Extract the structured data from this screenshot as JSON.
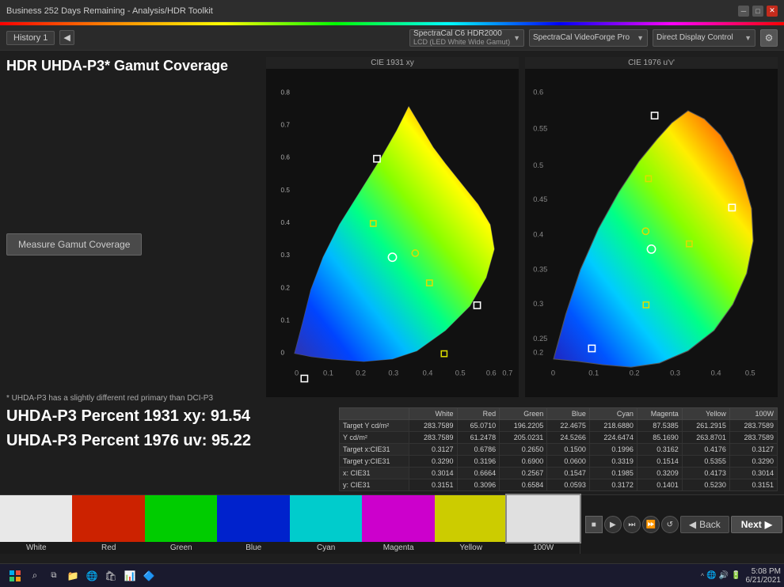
{
  "titlebar": {
    "title": "Business 252 Days Remaining  -  Analysis/HDR Toolkit",
    "controls": [
      "minimize",
      "maximize",
      "close"
    ]
  },
  "toolbar": {
    "history_label": "History 1",
    "device1": {
      "label": "SpectraCal C6 HDR2000",
      "sublabel": "LCD (LED White Wide Gamut)"
    },
    "device2": {
      "label": "SpectraCal VideoForge Pro"
    },
    "device3": {
      "label": "Direct Display Control"
    }
  },
  "main": {
    "panel_title": "HDR UHDA-P3* Gamut Coverage",
    "measure_btn": "Measure Gamut Coverage",
    "chart1_label": "CIE 1931 xy",
    "chart2_label": "CIE 1976 u'v'"
  },
  "bottom": {
    "footnote": "* UHDA-P3 has a slightly different red primary than DCI-P3",
    "stat1": "UHDA-P3 Percent 1931 xy: 91.54",
    "stat2": "UHDA-P3 Percent 1976 uv: 95.22"
  },
  "table": {
    "headers": [
      "",
      "White",
      "Red",
      "Green",
      "Blue",
      "Cyan",
      "Magenta",
      "Yellow",
      "100W"
    ],
    "rows": [
      {
        "label": "Target Y cd/m²",
        "values": [
          "283.7589",
          "65.0710",
          "196.2205",
          "22.4675",
          "218.6880",
          "87.5385",
          "261.2915",
          "283.7589"
        ]
      },
      {
        "label": "Y cd/m²",
        "values": [
          "283.7589",
          "61.2478",
          "205.0231",
          "24.5266",
          "224.6474",
          "85.1690",
          "263.8701",
          "283.7589"
        ]
      },
      {
        "label": "Target x:CIE31",
        "values": [
          "0.3127",
          "0.6786",
          "0.2650",
          "0.1500",
          "0.1996",
          "0.3162",
          "0.4176",
          "0.3127"
        ]
      },
      {
        "label": "Target y:CIE31",
        "values": [
          "0.3290",
          "0.3196",
          "0.6900",
          "0.0600",
          "0.3319",
          "0.1514",
          "0.5355",
          "0.3290"
        ]
      },
      {
        "label": "x: CIE31",
        "values": [
          "0.3014",
          "0.6664",
          "0.2567",
          "0.1547",
          "0.1985",
          "0.3209",
          "0.4173",
          "0.3014"
        ]
      },
      {
        "label": "y: CIE31",
        "values": [
          "0.3151",
          "0.3096",
          "0.6584",
          "0.0593",
          "0.3172",
          "0.1401",
          "0.5230",
          "0.3151"
        ]
      }
    ]
  },
  "swatches": [
    {
      "label": "White",
      "color": "#e8e8e8"
    },
    {
      "label": "Red",
      "color": "#cc2200"
    },
    {
      "label": "Green",
      "color": "#00cc00"
    },
    {
      "label": "Blue",
      "color": "#0022cc"
    },
    {
      "label": "Cyan",
      "color": "#00cccc"
    },
    {
      "label": "Magenta",
      "color": "#cc00cc"
    },
    {
      "label": "Yellow",
      "color": "#cccc00"
    },
    {
      "label": "100W",
      "color": "#e0e0e0"
    }
  ],
  "navigation": {
    "back_label": "Back",
    "next_label": "Next"
  },
  "taskbar": {
    "time": "5:08 PM",
    "date": "6/21/2021"
  }
}
